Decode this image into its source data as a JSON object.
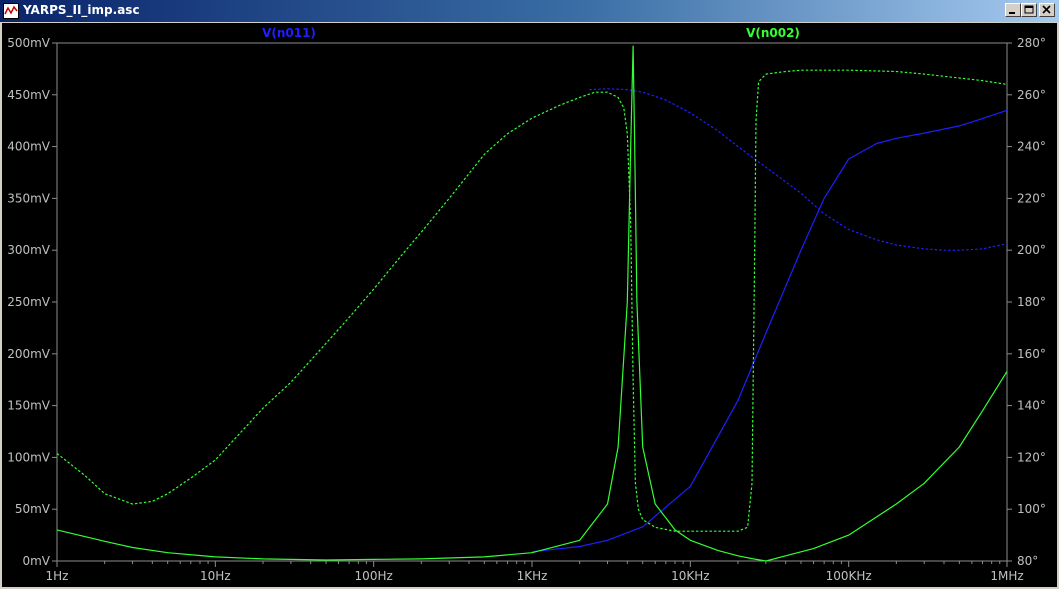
{
  "window": {
    "title": "YARPS_II_imp.asc",
    "controls": {
      "minimize": "_",
      "maximize": "□",
      "close": "×"
    }
  },
  "colors": {
    "background": "#000000",
    "axis": "#8c8c8c",
    "tick_label": "#c0c0c0",
    "series_blue": "#1f1fff",
    "series_green": "#33ff33"
  },
  "chart_data": {
    "type": "line",
    "x_scale": "log",
    "xlim": [
      1,
      1000000
    ],
    "xticks": [
      1,
      10,
      100,
      1000,
      10000,
      100000,
      1000000
    ],
    "xtick_labels": [
      "1Hz",
      "10Hz",
      "100Hz",
      "1KHz",
      "10KHz",
      "100KHz",
      "1MHz"
    ],
    "ylim_left": [
      0,
      500
    ],
    "yticks_left": [
      0,
      50,
      100,
      150,
      200,
      250,
      300,
      350,
      400,
      450,
      500
    ],
    "ytick_labels_left": [
      "0mV",
      "50mV",
      "100mV",
      "150mV",
      "200mV",
      "250mV",
      "300mV",
      "350mV",
      "400mV",
      "450mV",
      "500mV"
    ],
    "ylim_right": [
      80,
      280
    ],
    "yticks_right": [
      80,
      100,
      120,
      140,
      160,
      180,
      200,
      220,
      240,
      260,
      280
    ],
    "ytick_labels_right": [
      "80°",
      "100°",
      "120°",
      "140°",
      "160°",
      "180°",
      "200°",
      "220°",
      "240°",
      "260°",
      "280°"
    ],
    "legend": [
      {
        "label": "V(n011)",
        "color": "#1f1fff"
      },
      {
        "label": "V(n002)",
        "color": "#33ff33"
      }
    ],
    "series": [
      {
        "name": "V(n011)",
        "kind": "magnitude",
        "axis": "left",
        "unit": "mV",
        "style": "solid",
        "color": "#1f1fff",
        "points": [
          [
            1000,
            9
          ],
          [
            2000,
            14
          ],
          [
            3000,
            20
          ],
          [
            5000,
            33
          ],
          [
            10000,
            72
          ],
          [
            20000,
            155
          ],
          [
            30000,
            220
          ],
          [
            50000,
            300
          ],
          [
            70000,
            350
          ],
          [
            100000,
            388
          ],
          [
            150000,
            403
          ],
          [
            200000,
            408
          ],
          [
            300000,
            413
          ],
          [
            500000,
            420
          ],
          [
            700000,
            427
          ],
          [
            1000000,
            435
          ]
        ]
      },
      {
        "name": "V(n011)",
        "kind": "phase",
        "axis": "right",
        "unit": "deg",
        "style": "dashed",
        "color": "#1f1fff",
        "points": [
          [
            2300,
            262
          ],
          [
            3000,
            262.3
          ],
          [
            4000,
            262
          ],
          [
            5000,
            261
          ],
          [
            7000,
            258
          ],
          [
            10000,
            253
          ],
          [
            15000,
            246
          ],
          [
            20000,
            240
          ],
          [
            30000,
            232
          ],
          [
            50000,
            222
          ],
          [
            70000,
            214
          ],
          [
            100000,
            208
          ],
          [
            150000,
            204
          ],
          [
            200000,
            202
          ],
          [
            300000,
            200.5
          ],
          [
            400000,
            200
          ],
          [
            500000,
            200
          ],
          [
            700000,
            200.5
          ],
          [
            1000000,
            202.5
          ]
        ]
      },
      {
        "name": "V(n002)",
        "kind": "magnitude",
        "axis": "left",
        "unit": "mV",
        "style": "solid",
        "color": "#33ff33",
        "points": [
          [
            1,
            30
          ],
          [
            2,
            19
          ],
          [
            3,
            13
          ],
          [
            5,
            8
          ],
          [
            10,
            4
          ],
          [
            20,
            2
          ],
          [
            50,
            1
          ],
          [
            100,
            1.5
          ],
          [
            200,
            2
          ],
          [
            500,
            4
          ],
          [
            1000,
            8
          ],
          [
            2000,
            20
          ],
          [
            3000,
            55
          ],
          [
            3500,
            110
          ],
          [
            4000,
            250
          ],
          [
            4200,
            400
          ],
          [
            4350,
            497
          ],
          [
            4450,
            400
          ],
          [
            4600,
            250
          ],
          [
            5000,
            110
          ],
          [
            6000,
            55
          ],
          [
            8000,
            30
          ],
          [
            10000,
            20
          ],
          [
            15000,
            10
          ],
          [
            20000,
            5
          ],
          [
            25000,
            2
          ],
          [
            30000,
            0
          ],
          [
            40000,
            5
          ],
          [
            60000,
            12
          ],
          [
            100000,
            25
          ],
          [
            200000,
            55
          ],
          [
            300000,
            75
          ],
          [
            500000,
            110
          ],
          [
            700000,
            145
          ],
          [
            1000000,
            183
          ]
        ]
      },
      {
        "name": "V(n002)",
        "kind": "phase",
        "axis": "right",
        "unit": "deg",
        "style": "dashed",
        "color": "#33ff33",
        "points": [
          [
            1,
            121.5
          ],
          [
            1.5,
            113
          ],
          [
            2,
            106
          ],
          [
            3,
            102
          ],
          [
            4,
            103
          ],
          [
            5,
            106
          ],
          [
            7,
            112
          ],
          [
            10,
            119
          ],
          [
            20,
            139
          ],
          [
            30,
            149
          ],
          [
            50,
            164
          ],
          [
            70,
            174
          ],
          [
            100,
            185
          ],
          [
            150,
            198
          ],
          [
            200,
            207
          ],
          [
            300,
            220
          ],
          [
            500,
            237
          ],
          [
            700,
            245
          ],
          [
            1000,
            251
          ],
          [
            1500,
            256
          ],
          [
            2000,
            259
          ],
          [
            2500,
            261
          ],
          [
            3000,
            261
          ],
          [
            3500,
            259
          ],
          [
            3800,
            255
          ],
          [
            4000,
            245
          ],
          [
            4200,
            210
          ],
          [
            4350,
            150
          ],
          [
            4500,
            110
          ],
          [
            4700,
            100
          ],
          [
            5000,
            96
          ],
          [
            6000,
            93
          ],
          [
            8000,
            91.5
          ],
          [
            10000,
            91.5
          ],
          [
            15000,
            91.5
          ],
          [
            20000,
            91.5
          ],
          [
            23000,
            93
          ],
          [
            24500,
            110
          ],
          [
            25500,
            200
          ],
          [
            26000,
            250
          ],
          [
            27000,
            265
          ],
          [
            30000,
            268
          ],
          [
            40000,
            269
          ],
          [
            50000,
            269.5
          ],
          [
            100000,
            269.5
          ],
          [
            200000,
            269
          ],
          [
            300000,
            268
          ],
          [
            500000,
            266.5
          ],
          [
            700000,
            265.5
          ],
          [
            1000000,
            264
          ]
        ]
      }
    ]
  }
}
